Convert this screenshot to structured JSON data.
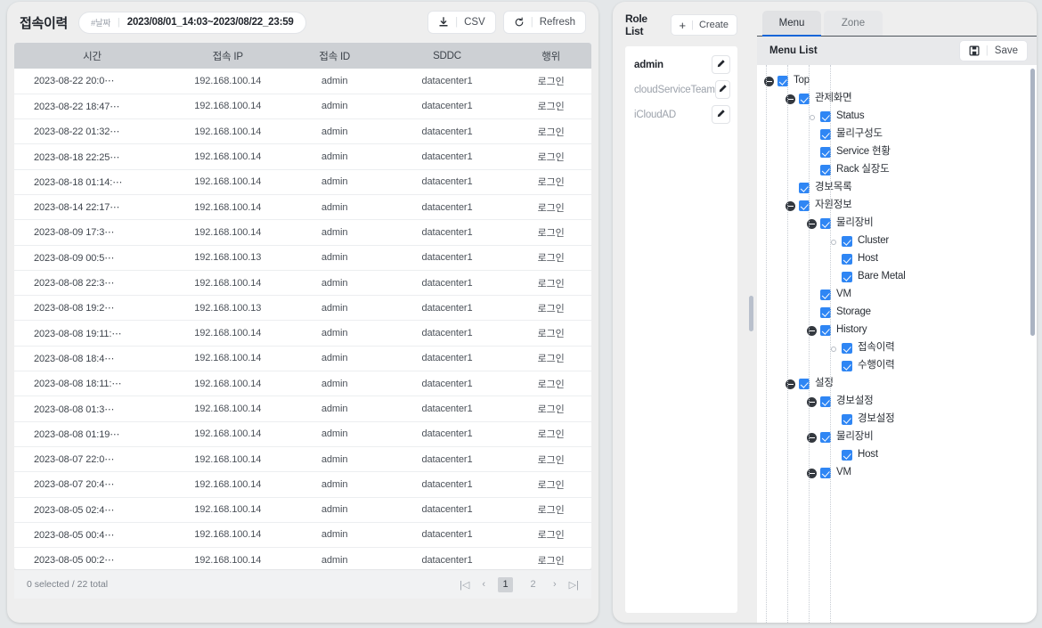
{
  "history_panel": {
    "title": "접속이력",
    "date_filter": {
      "tag": "#날짜",
      "value": "2023/08/01_14:03~2023/08/22_23:59"
    },
    "csv_button": "CSV",
    "refresh_button": "Refresh",
    "columns": [
      "시간",
      "접속 IP",
      "접속 ID",
      "SDDC",
      "행위"
    ],
    "rows": [
      {
        "time": "2023-08-22 20:0⋯",
        "ip": "192.168.100.14",
        "id": "admin",
        "sddc": "datacenter1",
        "action": "로그인"
      },
      {
        "time": "2023-08-22 18:47⋯",
        "ip": "192.168.100.14",
        "id": "admin",
        "sddc": "datacenter1",
        "action": "로그인"
      },
      {
        "time": "2023-08-22 01:32⋯",
        "ip": "192.168.100.14",
        "id": "admin",
        "sddc": "datacenter1",
        "action": "로그인"
      },
      {
        "time": "2023-08-18 22:25⋯",
        "ip": "192.168.100.14",
        "id": "admin",
        "sddc": "datacenter1",
        "action": "로그인"
      },
      {
        "time": "2023-08-18 01:14:⋯",
        "ip": "192.168.100.14",
        "id": "admin",
        "sddc": "datacenter1",
        "action": "로그인"
      },
      {
        "time": "2023-08-14 22:17⋯",
        "ip": "192.168.100.14",
        "id": "admin",
        "sddc": "datacenter1",
        "action": "로그인"
      },
      {
        "time": "2023-08-09 17:3⋯",
        "ip": "192.168.100.14",
        "id": "admin",
        "sddc": "datacenter1",
        "action": "로그인"
      },
      {
        "time": "2023-08-09 00:5⋯",
        "ip": "192.168.100.13",
        "id": "admin",
        "sddc": "datacenter1",
        "action": "로그인"
      },
      {
        "time": "2023-08-08 22:3⋯",
        "ip": "192.168.100.14",
        "id": "admin",
        "sddc": "datacenter1",
        "action": "로그인"
      },
      {
        "time": "2023-08-08 19:2⋯",
        "ip": "192.168.100.13",
        "id": "admin",
        "sddc": "datacenter1",
        "action": "로그인"
      },
      {
        "time": "2023-08-08 19:11:⋯",
        "ip": "192.168.100.14",
        "id": "admin",
        "sddc": "datacenter1",
        "action": "로그인"
      },
      {
        "time": "2023-08-08 18:4⋯",
        "ip": "192.168.100.14",
        "id": "admin",
        "sddc": "datacenter1",
        "action": "로그인"
      },
      {
        "time": "2023-08-08 18:11:⋯",
        "ip": "192.168.100.14",
        "id": "admin",
        "sddc": "datacenter1",
        "action": "로그인"
      },
      {
        "time": "2023-08-08 01:3⋯",
        "ip": "192.168.100.14",
        "id": "admin",
        "sddc": "datacenter1",
        "action": "로그인"
      },
      {
        "time": "2023-08-08 01:19⋯",
        "ip": "192.168.100.14",
        "id": "admin",
        "sddc": "datacenter1",
        "action": "로그인"
      },
      {
        "time": "2023-08-07 22:0⋯",
        "ip": "192.168.100.14",
        "id": "admin",
        "sddc": "datacenter1",
        "action": "로그인"
      },
      {
        "time": "2023-08-07 20:4⋯",
        "ip": "192.168.100.14",
        "id": "admin",
        "sddc": "datacenter1",
        "action": "로그인"
      },
      {
        "time": "2023-08-05 02:4⋯",
        "ip": "192.168.100.14",
        "id": "admin",
        "sddc": "datacenter1",
        "action": "로그인"
      },
      {
        "time": "2023-08-05 00:4⋯",
        "ip": "192.168.100.14",
        "id": "admin",
        "sddc": "datacenter1",
        "action": "로그인"
      },
      {
        "time": "2023-08-05 00:2⋯",
        "ip": "192.168.100.14",
        "id": "admin",
        "sddc": "datacenter1",
        "action": "로그인"
      }
    ],
    "footer": {
      "status": "0 selected / 22 total",
      "pages": [
        "1",
        "2"
      ],
      "active_page": "1",
      "first_label": "|◁",
      "prev_label": "‹",
      "next_label": "›",
      "last_label": "▷|"
    }
  },
  "role_panel": {
    "title": "Role List",
    "create_button": "Create",
    "roles": [
      {
        "name": "admin",
        "selected": true
      },
      {
        "name": "cloudServiceTeam",
        "selected": false
      },
      {
        "name": "iCloudAD",
        "selected": false
      }
    ]
  },
  "menu_panel": {
    "tabs": [
      {
        "label": "Menu",
        "active": true
      },
      {
        "label": "Zone",
        "active": false
      }
    ],
    "subtitle": "Menu List",
    "save_button": "Save",
    "tree": [
      {
        "label": "Top",
        "depth": 0,
        "toggle": true,
        "checked": true
      },
      {
        "label": "관제화면",
        "depth": 1,
        "toggle": true,
        "checked": true
      },
      {
        "label": "Status",
        "depth": 2,
        "toggle": false,
        "checked": true
      },
      {
        "label": "물리구성도",
        "depth": 2,
        "toggle": false,
        "checked": true,
        "nodot": true
      },
      {
        "label": "Service 현황",
        "depth": 2,
        "toggle": false,
        "checked": true,
        "nodot": true
      },
      {
        "label": "Rack 실장도",
        "depth": 2,
        "toggle": false,
        "checked": true,
        "nodot": true
      },
      {
        "label": "경보목록",
        "depth": 1,
        "toggle": false,
        "checked": true,
        "nodot": true
      },
      {
        "label": "자원정보",
        "depth": 1,
        "toggle": true,
        "checked": true
      },
      {
        "label": "물리장비",
        "depth": 2,
        "toggle": true,
        "checked": true
      },
      {
        "label": "Cluster",
        "depth": 3,
        "toggle": false,
        "checked": true
      },
      {
        "label": "Host",
        "depth": 3,
        "toggle": false,
        "checked": true,
        "nodot": true
      },
      {
        "label": "Bare Metal",
        "depth": 3,
        "toggle": false,
        "checked": true,
        "nodot": true
      },
      {
        "label": "VM",
        "depth": 2,
        "toggle": false,
        "checked": true,
        "nodot": true
      },
      {
        "label": "Storage",
        "depth": 2,
        "toggle": false,
        "checked": true,
        "nodot": true
      },
      {
        "label": "History",
        "depth": 2,
        "toggle": true,
        "checked": true
      },
      {
        "label": "접속이력",
        "depth": 3,
        "toggle": false,
        "checked": true
      },
      {
        "label": "수행이력",
        "depth": 3,
        "toggle": false,
        "checked": true,
        "nodot": true
      },
      {
        "label": "설정",
        "depth": 1,
        "toggle": true,
        "checked": true
      },
      {
        "label": "경보설정",
        "depth": 2,
        "toggle": true,
        "checked": true
      },
      {
        "label": "경보설정",
        "depth": 3,
        "toggle": false,
        "checked": true,
        "nodot": true
      },
      {
        "label": "물리장비",
        "depth": 2,
        "toggle": true,
        "checked": true
      },
      {
        "label": "Host",
        "depth": 3,
        "toggle": false,
        "checked": true,
        "nodot": true
      },
      {
        "label": "VM",
        "depth": 2,
        "toggle": true,
        "checked": true
      }
    ]
  },
  "colors": {
    "accent": "#2f86f4",
    "tab_underline": "#1565d8",
    "header_bg": "#cdd0d4",
    "page_bg": "#e4e7e9"
  }
}
